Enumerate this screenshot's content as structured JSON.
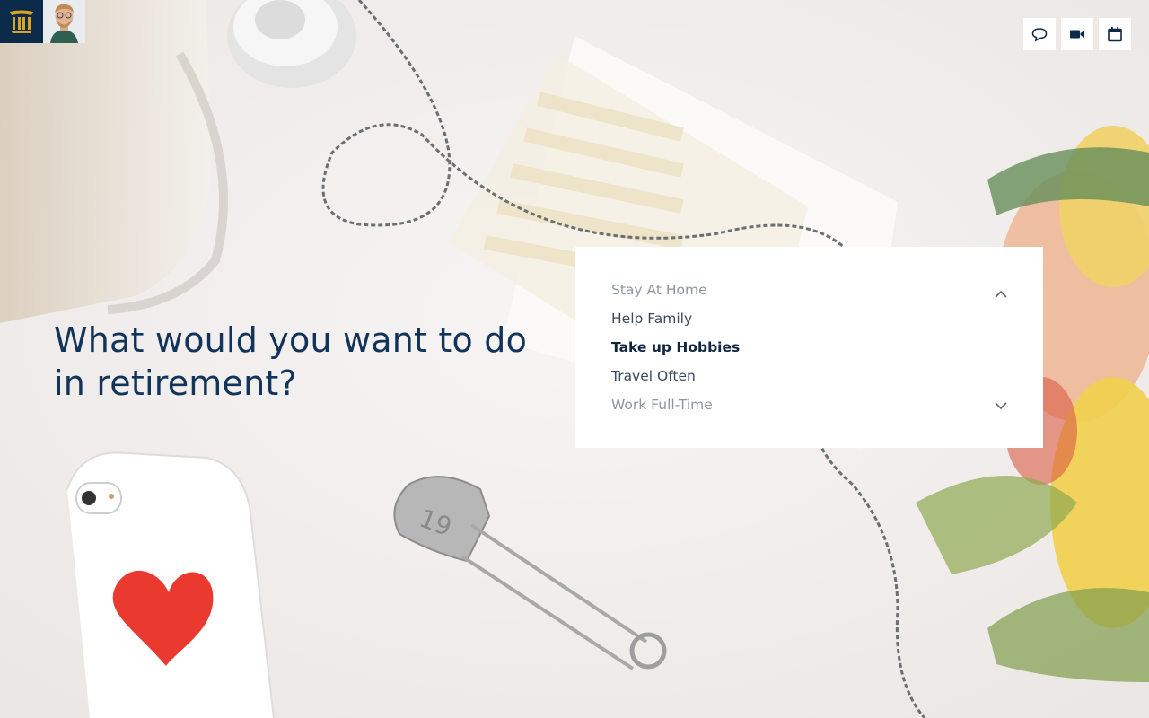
{
  "question": {
    "line1": "What would you want to do",
    "line2": "in retirement?"
  },
  "options": [
    {
      "label": "Stay At Home",
      "state": "faded"
    },
    {
      "label": "Help Family",
      "state": "normal"
    },
    {
      "label": "Take up Hobbies",
      "state": "selected"
    },
    {
      "label": "Travel Often",
      "state": "normal"
    },
    {
      "label": "Work Full-Time",
      "state": "faded"
    }
  ],
  "selected_option": "Take up Hobbies",
  "icons": {
    "brand": "columns-logo-icon",
    "chat": "chat-bubble-icon",
    "video": "video-camera-icon",
    "calendar": "calendar-icon",
    "scroll_up": "chevron-up-icon",
    "scroll_down": "chevron-down-icon"
  },
  "colors": {
    "brand_navy": "#0c2a4a",
    "brand_gold": "#d9a520",
    "heading": "#12345a",
    "option_text": "#3a4a5c",
    "option_faded": "#8d969f"
  },
  "background": {
    "pin_number": "19"
  }
}
